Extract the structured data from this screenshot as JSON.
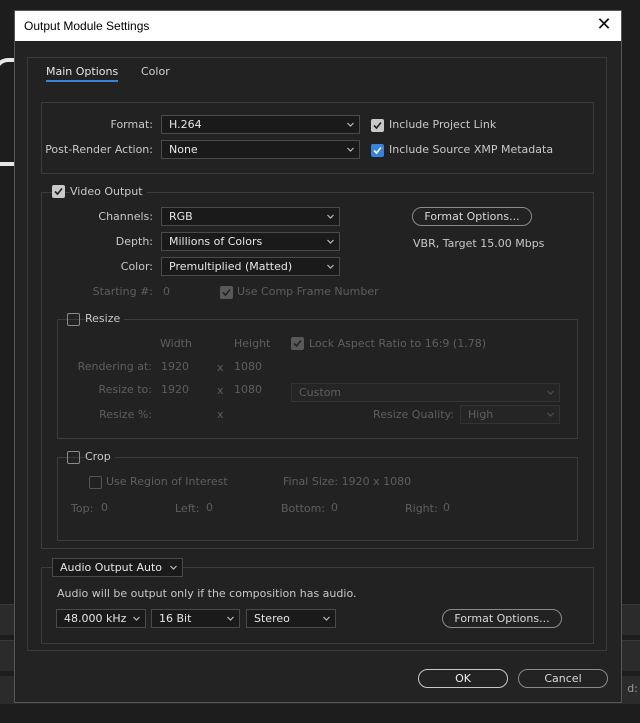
{
  "background": {
    "right_text": "d:"
  },
  "dialog": {
    "title": "Output Module Settings",
    "close_glyph": "✕"
  },
  "tabs": [
    {
      "label": "Main Options",
      "active": true
    },
    {
      "label": "Color",
      "active": false
    }
  ],
  "format_section": {
    "format_label": "Format:",
    "format_value": "H.264",
    "post_render_label": "Post-Render Action:",
    "post_render_value": "None",
    "include_project_link": {
      "label": "Include Project Link",
      "checked": true
    },
    "include_xmp": {
      "label": "Include Source XMP Metadata",
      "checked": true
    }
  },
  "video_output": {
    "label": "Video Output",
    "checked": true,
    "channels_label": "Channels:",
    "channels_value": "RGB",
    "depth_label": "Depth:",
    "depth_value": "Millions of Colors",
    "color_label": "Color:",
    "color_value": "Premultiplied (Matted)",
    "starting_label": "Starting #:",
    "starting_value": "0",
    "use_comp_frame": {
      "label": "Use Comp Frame Number",
      "checked": true
    },
    "format_options_label": "Format Options...",
    "bitrate_text": "VBR, Target 15.00 Mbps"
  },
  "resize": {
    "label": "Resize",
    "checked": false,
    "width_header": "Width",
    "height_header": "Height",
    "lock_aspect": {
      "label": "Lock Aspect Ratio to 16:9 (1.78)",
      "checked": true
    },
    "rendering_at_label": "Rendering at:",
    "rendering_w": "1920",
    "rendering_h": "1080",
    "resize_to_label": "Resize to:",
    "resize_to_w": "1920",
    "resize_to_h": "1080",
    "x_glyph": "x",
    "preset_value": "Custom",
    "resize_pct_label": "Resize %:",
    "quality_label": "Resize Quality:",
    "quality_value": "High"
  },
  "crop": {
    "label": "Crop",
    "checked": false,
    "use_roi": {
      "label": "Use Region of Interest",
      "checked": false
    },
    "final_size": "Final Size: 1920 x 1080",
    "top_label": "Top:",
    "top_value": "0",
    "left_label": "Left:",
    "left_value": "0",
    "bottom_label": "Bottom:",
    "bottom_value": "0",
    "right_label": "Right:",
    "right_value": "0"
  },
  "audio": {
    "mode_value": "Audio Output Auto",
    "note": "Audio will be output only if the composition has audio.",
    "rate_value": "48.000 kHz",
    "bits_value": "16 Bit",
    "channels_value": "Stereo",
    "format_options_label": "Format Options..."
  },
  "footer": {
    "ok_label": "OK",
    "cancel_label": "Cancel"
  },
  "colors": {
    "accent": "#3a82d6",
    "background": "#232323",
    "field": "#1a1a1a"
  },
  "icons": {
    "dropdown": "chevron-down-icon",
    "check": "checkmark-icon",
    "close": "close-icon"
  }
}
